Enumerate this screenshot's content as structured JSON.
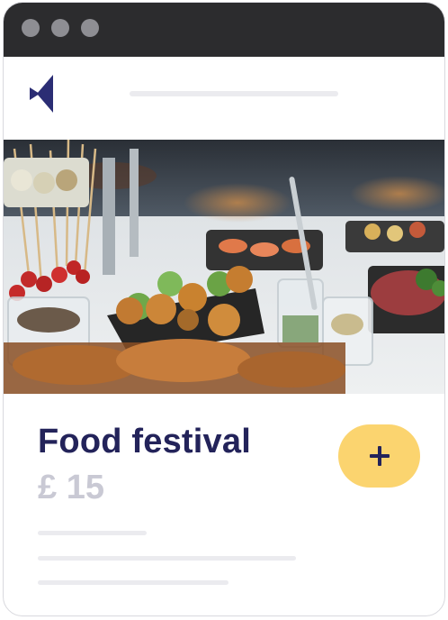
{
  "card": {
    "title": "Food festival",
    "price": "£ 15"
  },
  "add_button": {
    "icon": "plus-icon"
  },
  "hero_image": {
    "subject": "food-buffet-photo"
  },
  "colors": {
    "titlebar": "#2c2c2e",
    "window_dots": "#8e8e93",
    "brand_navy": "#23235a",
    "price_gray": "#c9c9d4",
    "accent_yellow": "#fbd46f",
    "placeholder_line": "#ebebef"
  }
}
